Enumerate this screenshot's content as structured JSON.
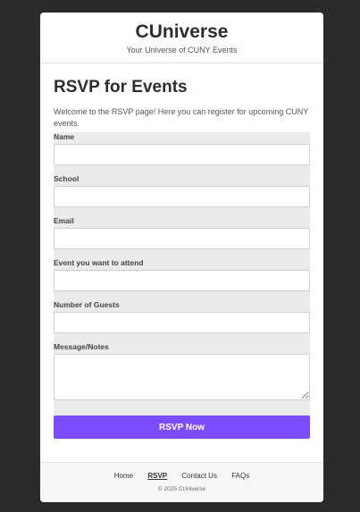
{
  "header": {
    "brand": "CUniverse",
    "tagline": "Your Universe of CUNY Events"
  },
  "main": {
    "title": "RSVP for Events",
    "intro": "Welcome to the RSVP page! Here you can register for upcoming CUNY events."
  },
  "form": {
    "fields": [
      {
        "label": "Name",
        "value": "",
        "placeholder": ""
      },
      {
        "label": "School",
        "value": "",
        "placeholder": ""
      },
      {
        "label": "Email",
        "value": "",
        "placeholder": ""
      },
      {
        "label": "Event you want to attend",
        "value": "",
        "placeholder": ""
      },
      {
        "label": "Number of Guests",
        "value": "",
        "placeholder": ""
      },
      {
        "label": "Message/Notes",
        "value": "",
        "placeholder": ""
      }
    ],
    "submit_label": "RSVP Now"
  },
  "footer": {
    "nav": [
      "Home",
      "RSVP",
      "Contact Us",
      "FAQs"
    ],
    "active_nav": "RSVP",
    "copyright": "© 2025 CUniverse"
  },
  "colors": {
    "accent": "#7c4dff",
    "page_background": "#2b2b2b",
    "form_background": "#ebebeb"
  }
}
